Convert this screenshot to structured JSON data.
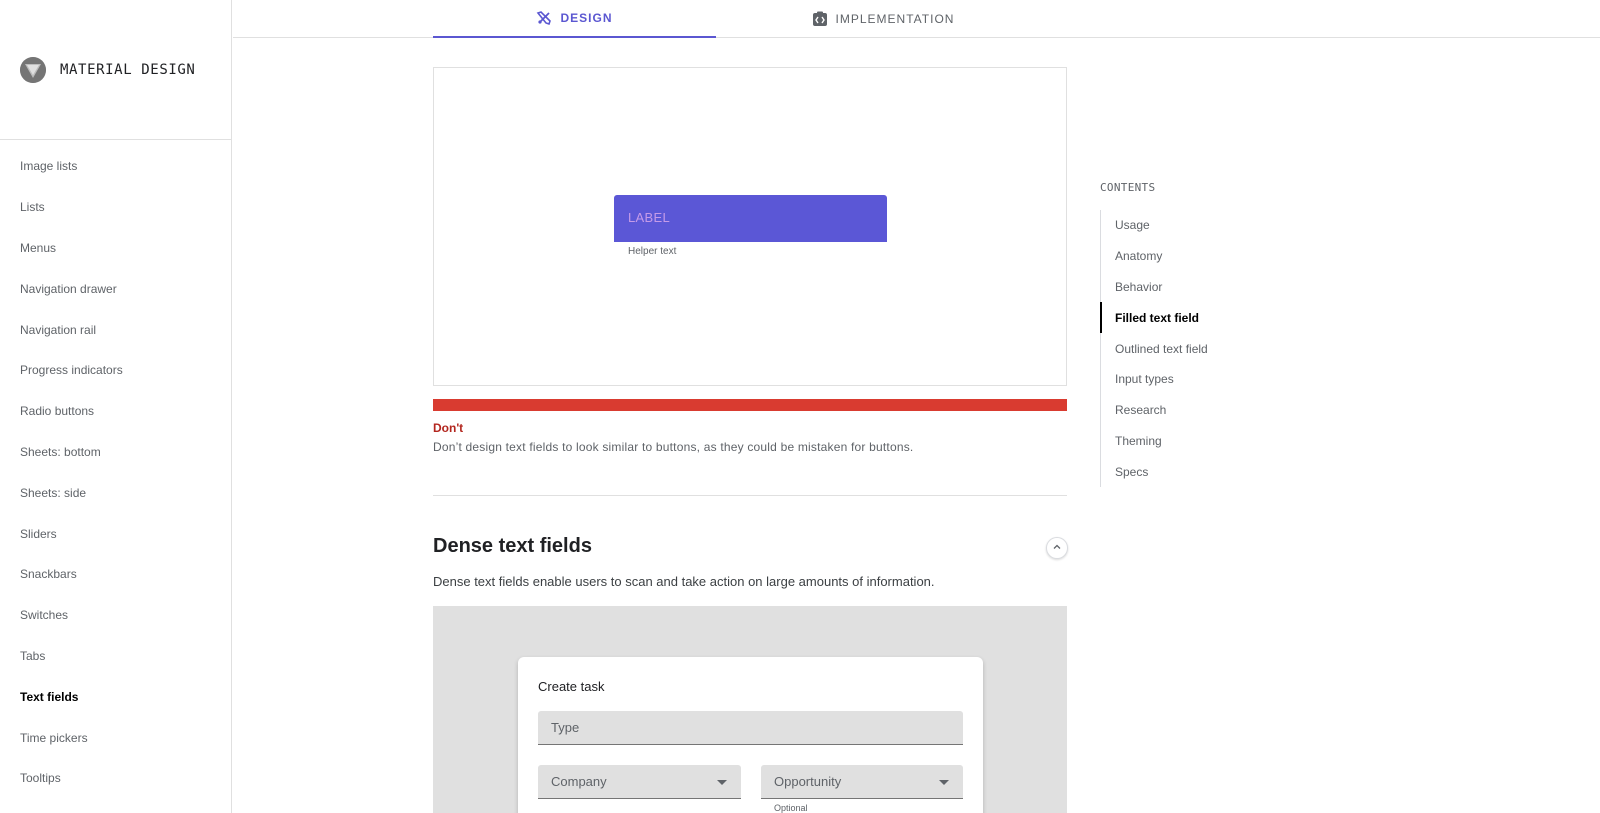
{
  "brand": {
    "name": "MATERIAL DESIGN"
  },
  "sidebar": {
    "items": [
      {
        "label": "Image lists",
        "active": false
      },
      {
        "label": "Lists",
        "active": false
      },
      {
        "label": "Menus",
        "active": false
      },
      {
        "label": "Navigation drawer",
        "active": false
      },
      {
        "label": "Navigation rail",
        "active": false
      },
      {
        "label": "Progress indicators",
        "active": false
      },
      {
        "label": "Radio buttons",
        "active": false
      },
      {
        "label": "Sheets: bottom",
        "active": false
      },
      {
        "label": "Sheets: side",
        "active": false
      },
      {
        "label": "Sliders",
        "active": false
      },
      {
        "label": "Snackbars",
        "active": false
      },
      {
        "label": "Switches",
        "active": false
      },
      {
        "label": "Tabs",
        "active": false
      },
      {
        "label": "Text fields",
        "active": true
      },
      {
        "label": "Time pickers",
        "active": false
      },
      {
        "label": "Tooltips",
        "active": false
      }
    ]
  },
  "tabs": [
    {
      "label": "DESIGN",
      "icon": "design-tools-icon",
      "active": true
    },
    {
      "label": "IMPLEMENTATION",
      "icon": "code-icon",
      "active": false
    }
  ],
  "example": {
    "button_label": "LABEL",
    "helper_text": "Helper text",
    "dont_title": "Don't",
    "dont_text": "Don’t design text fields to look similar to buttons, as they could be mistaken for buttons."
  },
  "section": {
    "title": "Dense text fields",
    "description": "Dense text fields enable users to scan and take action on large amounts of information."
  },
  "preview": {
    "card_title": "Create task",
    "type_label": "Type",
    "company_label": "Company",
    "opportunity_label": "Opportunity",
    "opportunity_helper": "Optional"
  },
  "toc": {
    "title": "CONTENTS",
    "items": [
      {
        "label": "Usage",
        "active": false
      },
      {
        "label": "Anatomy",
        "active": false
      },
      {
        "label": "Behavior",
        "active": false
      },
      {
        "label": "Filled text field",
        "active": true
      },
      {
        "label": "Outlined text field",
        "active": false
      },
      {
        "label": "Input types",
        "active": false
      },
      {
        "label": "Research",
        "active": false
      },
      {
        "label": "Theming",
        "active": false
      },
      {
        "label": "Specs",
        "active": false
      }
    ]
  },
  "colors": {
    "accent": "#5b57d1",
    "dont_red": "#d93b30",
    "button_fill": "#5b57d6"
  }
}
